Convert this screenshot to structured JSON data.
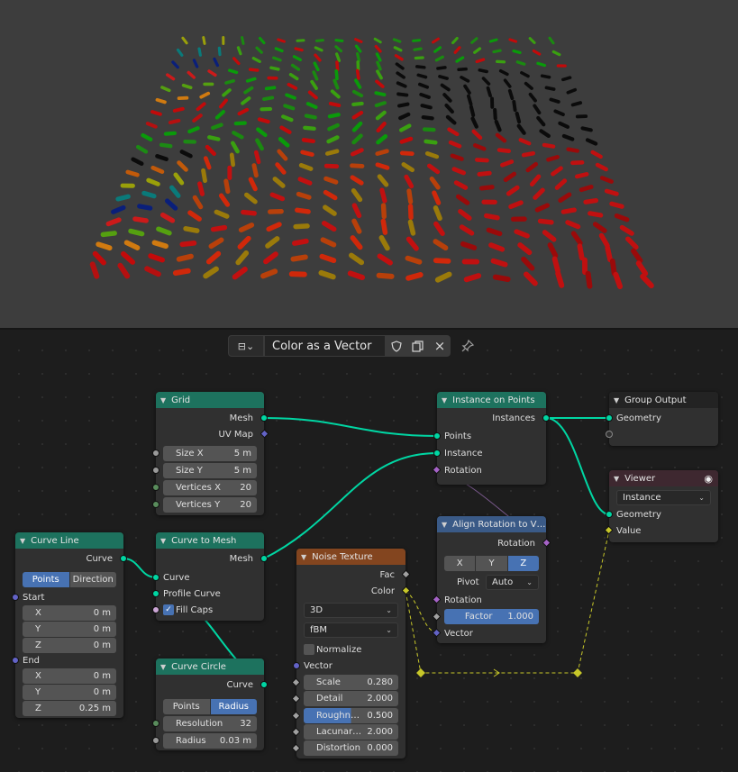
{
  "header": {
    "editor_type": "⊟⌄",
    "node_tree_name": "Color as a Vector",
    "fake_user_icon": "shield-icon",
    "duplicate_icon": "duplicate-icon",
    "close_icon": "×",
    "pin_icon": "pin-icon"
  },
  "colors": {
    "geometry_header": "#1d725e",
    "texture_header": "#83451f",
    "vector_header": "#3a5a87",
    "link_geometry": "#00d6a3",
    "link_color": "#c7c729",
    "accent_blue": "#4772b3"
  },
  "nodes": {
    "grid": {
      "title": "Grid",
      "out_mesh": "Mesh",
      "out_uv": "UV Map",
      "size_x_label": "Size X",
      "size_x_value": "5 m",
      "size_y_label": "Size Y",
      "size_y_value": "5 m",
      "vx_label": "Vertices X",
      "vx_value": "20",
      "vy_label": "Vertices Y",
      "vy_value": "20"
    },
    "curve_line": {
      "title": "Curve Line",
      "out_curve": "Curve",
      "mode_points": "Points",
      "mode_direction": "Direction",
      "start_label": "Start",
      "sx": "X",
      "sx_v": "0 m",
      "sy": "Y",
      "sy_v": "0 m",
      "sz": "Z",
      "sz_v": "0 m",
      "end_label": "End",
      "ex": "X",
      "ex_v": "0 m",
      "ey": "Y",
      "ey_v": "0 m",
      "ez": "Z",
      "ez_v": "0.25 m"
    },
    "curve_to_mesh": {
      "title": "Curve to Mesh",
      "out_mesh": "Mesh",
      "in_curve": "Curve",
      "in_profile": "Profile Curve",
      "fill_caps": "Fill Caps"
    },
    "curve_circle": {
      "title": "Curve Circle",
      "out_curve": "Curve",
      "mode_points": "Points",
      "mode_radius": "Radius",
      "res_label": "Resolution",
      "res_value": "32",
      "radius_label": "Radius",
      "radius_value": "0.03 m"
    },
    "noise": {
      "title": "Noise Texture",
      "out_fac": "Fac",
      "out_color": "Color",
      "dim": "3D",
      "type": "fBM",
      "normalize": "Normalize",
      "in_vector": "Vector",
      "scale_label": "Scale",
      "scale_value": "0.280",
      "detail_label": "Detail",
      "detail_value": "2.000",
      "rough_label": "Roughn…",
      "rough_value": "0.500",
      "lacun_label": "Lacunar…",
      "lacun_value": "2.000",
      "dist_label": "Distortion",
      "dist_value": "0.000"
    },
    "instance_on_points": {
      "title": "Instance on Points",
      "out_instances": "Instances",
      "in_points": "Points",
      "in_instance": "Instance",
      "in_rotation": "Rotation"
    },
    "align_rotation": {
      "title": "Align Rotation to V…",
      "out_rotation": "Rotation",
      "axis_x": "X",
      "axis_y": "Y",
      "axis_z": "Z",
      "pivot_label": "Pivot",
      "pivot_value": "Auto",
      "in_rotation": "Rotation",
      "factor_label": "Factor",
      "factor_value": "1.000",
      "in_vector": "Vector"
    },
    "group_output": {
      "title": "Group Output",
      "in_geometry": "Geometry"
    },
    "viewer": {
      "title": "Viewer",
      "domain": "Instance",
      "in_geometry": "Geometry",
      "in_value": "Value"
    }
  }
}
